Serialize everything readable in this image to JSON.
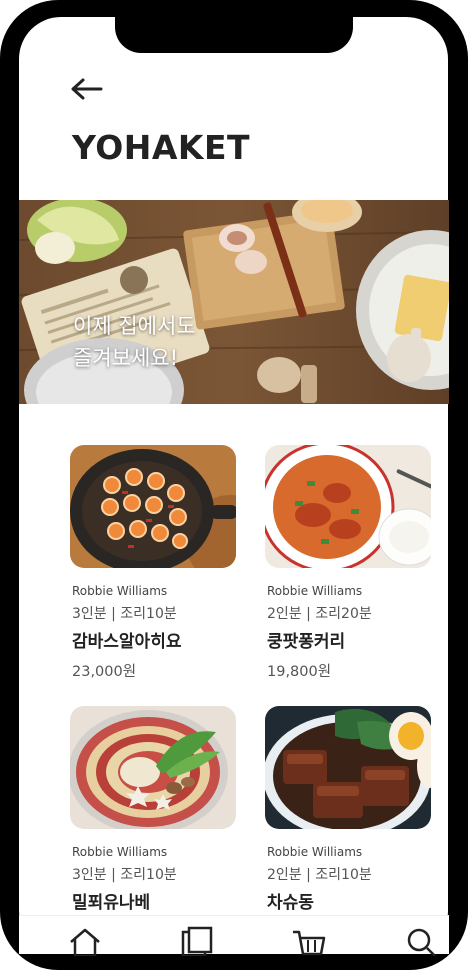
{
  "app": {
    "brand": "YOHAKET"
  },
  "nav": {
    "back_icon": "arrow-left-icon"
  },
  "hero": {
    "caption": "이제 집에서도\n즐겨보세요!"
  },
  "products": [
    {
      "author": "Robbie Williams",
      "meta": "3인분 | 조리10분",
      "title": "감바스알아히요",
      "price": "23,000원",
      "image": "gambas-skillet"
    },
    {
      "author": "Robbie Williams",
      "meta": "2인분 | 조리20분",
      "title": "쿵팟퐁커리",
      "price": "19,800원",
      "image": "crab-curry"
    },
    {
      "author": "Robbie Williams",
      "meta": "3인분 | 조리10분",
      "title": "밀푀유나베",
      "price": "",
      "image": "mille-feuille-nabe"
    },
    {
      "author": "Robbie Williams",
      "meta": "2인분 | 조리10분",
      "title": "차슈동",
      "price": "",
      "image": "chashu-don"
    }
  ],
  "tabbar": {
    "icons": [
      "home-icon",
      "documents-icon",
      "cart-icon",
      "search-icon"
    ]
  }
}
